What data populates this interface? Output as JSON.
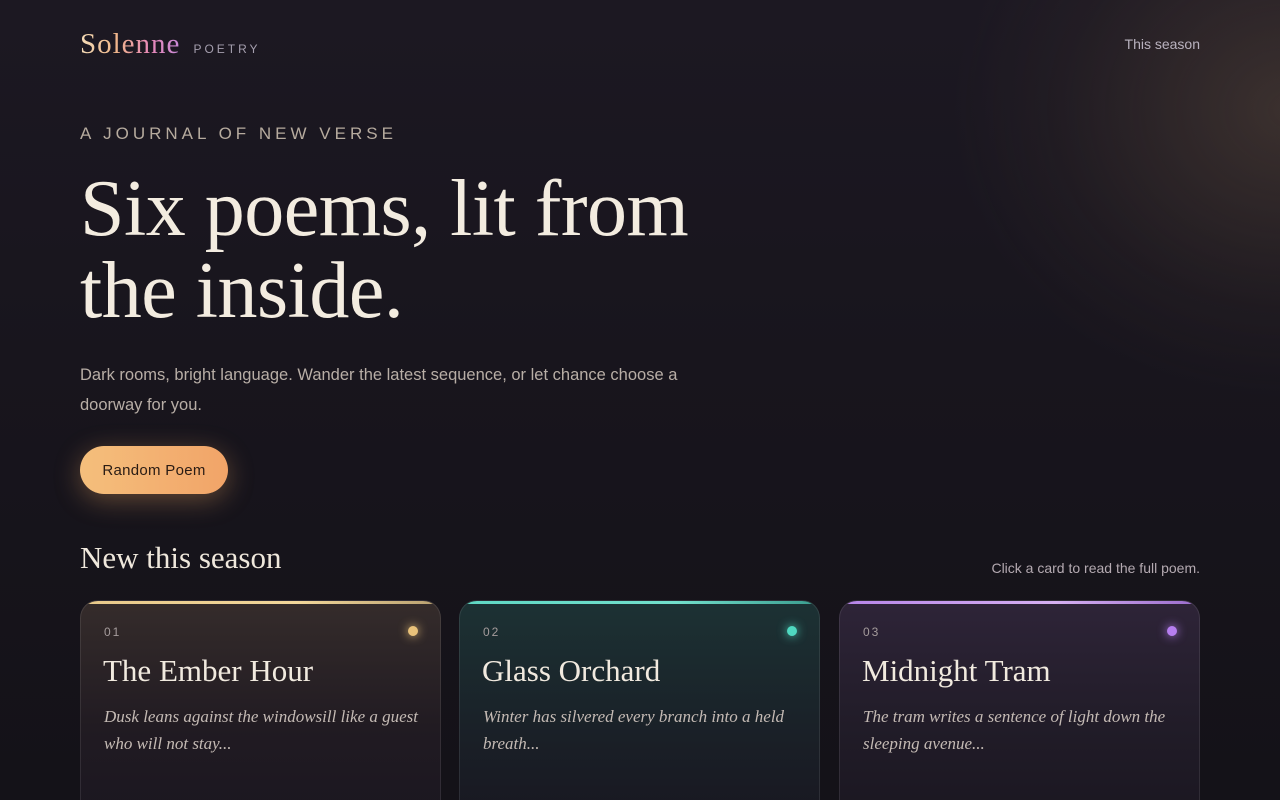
{
  "header": {
    "logo": "Solenne",
    "logo_sub": "POETRY",
    "nav_link": "This season"
  },
  "hero": {
    "eyebrow": "A JOURNAL OF NEW VERSE",
    "title_line1": "Six poems, lit from",
    "title_line2": "the inside.",
    "subtitle": "Dark rooms, bright language. Wander the latest sequence, or let chance choose a doorway for you.",
    "cta_label": "Random Poem"
  },
  "section": {
    "title": "New this season",
    "hint": "Click a card to read the full poem."
  },
  "cards": [
    {
      "number": "01",
      "title": "The Ember Hour",
      "excerpt": "Dusk leans against the windowsill like a guest who will not stay...",
      "accent": "#e9c27a"
    },
    {
      "number": "02",
      "title": "Glass Orchard",
      "excerpt": "Winter has silvered every branch into a held breath...",
      "accent": "#4fd8c0"
    },
    {
      "number": "03",
      "title": "Midnight Tram",
      "excerpt": "The tram writes a sentence of light down the sleeping avenue...",
      "accent": "#b67ef0"
    }
  ]
}
